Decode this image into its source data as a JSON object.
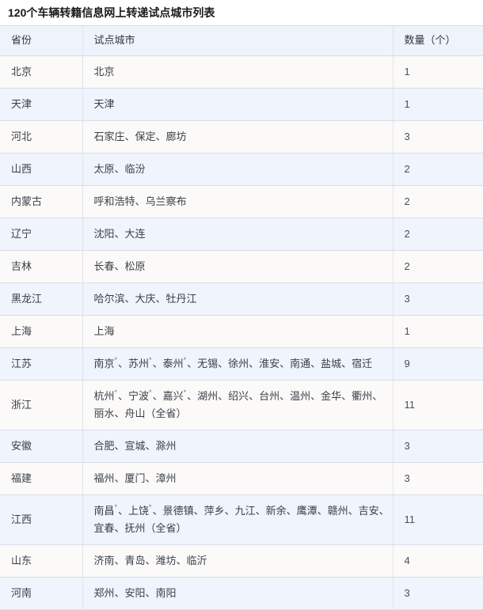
{
  "table": {
    "title": "120个车辆转籍信息网上转递试点城市列表",
    "columns": [
      {
        "key": "province",
        "label": "省份"
      },
      {
        "key": "cities",
        "label": "试点城市"
      },
      {
        "key": "count",
        "label": "数量（个）"
      }
    ],
    "star_marker": "*",
    "rows": [
      {
        "province": "北京",
        "cities_parts": [
          {
            "text": "北京"
          }
        ],
        "cities": "北京",
        "count": "1"
      },
      {
        "province": "天津",
        "cities_parts": [
          {
            "text": "天津"
          }
        ],
        "cities": "天津",
        "count": "1"
      },
      {
        "province": "河北",
        "cities_parts": [
          {
            "text": "石家庄、保定、廊坊"
          }
        ],
        "cities": "石家庄、保定、廊坊",
        "count": "3"
      },
      {
        "province": "山西",
        "cities_parts": [
          {
            "text": "太原、临汾"
          }
        ],
        "cities": "太原、临汾",
        "count": "2"
      },
      {
        "province": "内蒙古",
        "cities_parts": [
          {
            "text": "呼和浩特、乌兰察布"
          }
        ],
        "cities": "呼和浩特、乌兰察布",
        "count": "2"
      },
      {
        "province": "辽宁",
        "cities_parts": [
          {
            "text": "沈阳、大连"
          }
        ],
        "cities": "沈阳、大连",
        "count": "2"
      },
      {
        "province": "吉林",
        "cities_parts": [
          {
            "text": "长春、松原"
          }
        ],
        "cities": "长春、松原",
        "count": "2"
      },
      {
        "province": "黑龙江",
        "cities_parts": [
          {
            "text": "哈尔滨、大庆、牡丹江"
          }
        ],
        "cities": "哈尔滨、大庆、牡丹江",
        "count": "3"
      },
      {
        "province": "上海",
        "cities_parts": [
          {
            "text": "上海"
          }
        ],
        "cities": "上海",
        "count": "1"
      },
      {
        "province": "江苏",
        "cities_parts": [
          {
            "text": "南京",
            "star": true
          },
          {
            "text": "、苏州",
            "star": true
          },
          {
            "text": "、泰州",
            "star": true
          },
          {
            "text": "、无锡、徐州、淮安、南通、盐城、宿迁"
          }
        ],
        "cities": "南京*、苏州*、泰州*、无锡、徐州、淮安、南通、盐城、宿迁",
        "count": "9"
      },
      {
        "province": "浙江",
        "cities_parts": [
          {
            "text": "杭州",
            "star": true
          },
          {
            "text": "、宁波",
            "star": true
          },
          {
            "text": "、嘉兴",
            "star": true
          },
          {
            "text": "、湖州、绍兴、台州、温州、金华、衢州、丽水、舟山（全省）"
          }
        ],
        "cities": "杭州*、宁波*、嘉兴*、湖州、绍兴、台州、温州、金华、衢州、丽水、舟山（全省）",
        "count": "11"
      },
      {
        "province": "安徽",
        "cities_parts": [
          {
            "text": "合肥、宣城、滁州"
          }
        ],
        "cities": "合肥、宣城、滁州",
        "count": "3"
      },
      {
        "province": "福建",
        "cities_parts": [
          {
            "text": "福州、厦门、漳州"
          }
        ],
        "cities": "福州、厦门、漳州",
        "count": "3"
      },
      {
        "province": "江西",
        "cities_parts": [
          {
            "text": "南昌",
            "star": true
          },
          {
            "text": "、上饶",
            "star": true
          },
          {
            "text": "、景德镇、萍乡、九江、新余、鹰潭、赣州、吉安、宜春、抚州（全省）"
          }
        ],
        "cities": "南昌*、上饶*、景德镇、萍乡、九江、新余、鹰潭、赣州、吉安、宜春、抚州（全省）",
        "count": "11"
      },
      {
        "province": "山东",
        "cities_parts": [
          {
            "text": "济南、青岛、潍坊、临沂"
          }
        ],
        "cities": "济南、青岛、潍坊、临沂",
        "count": "4"
      },
      {
        "province": "河南",
        "cities_parts": [
          {
            "text": "郑州、安阳、南阳"
          }
        ],
        "cities": "郑州、安阳、南阳",
        "count": "3"
      }
    ]
  },
  "colors": {
    "header_bg": "#eef3fc",
    "row_odd_bg": "#fbfaf9",
    "row_even_bg": "#eff4fd",
    "border": "#d9dde6",
    "text": "#3a3f46",
    "title_text": "#1a1a1a"
  }
}
